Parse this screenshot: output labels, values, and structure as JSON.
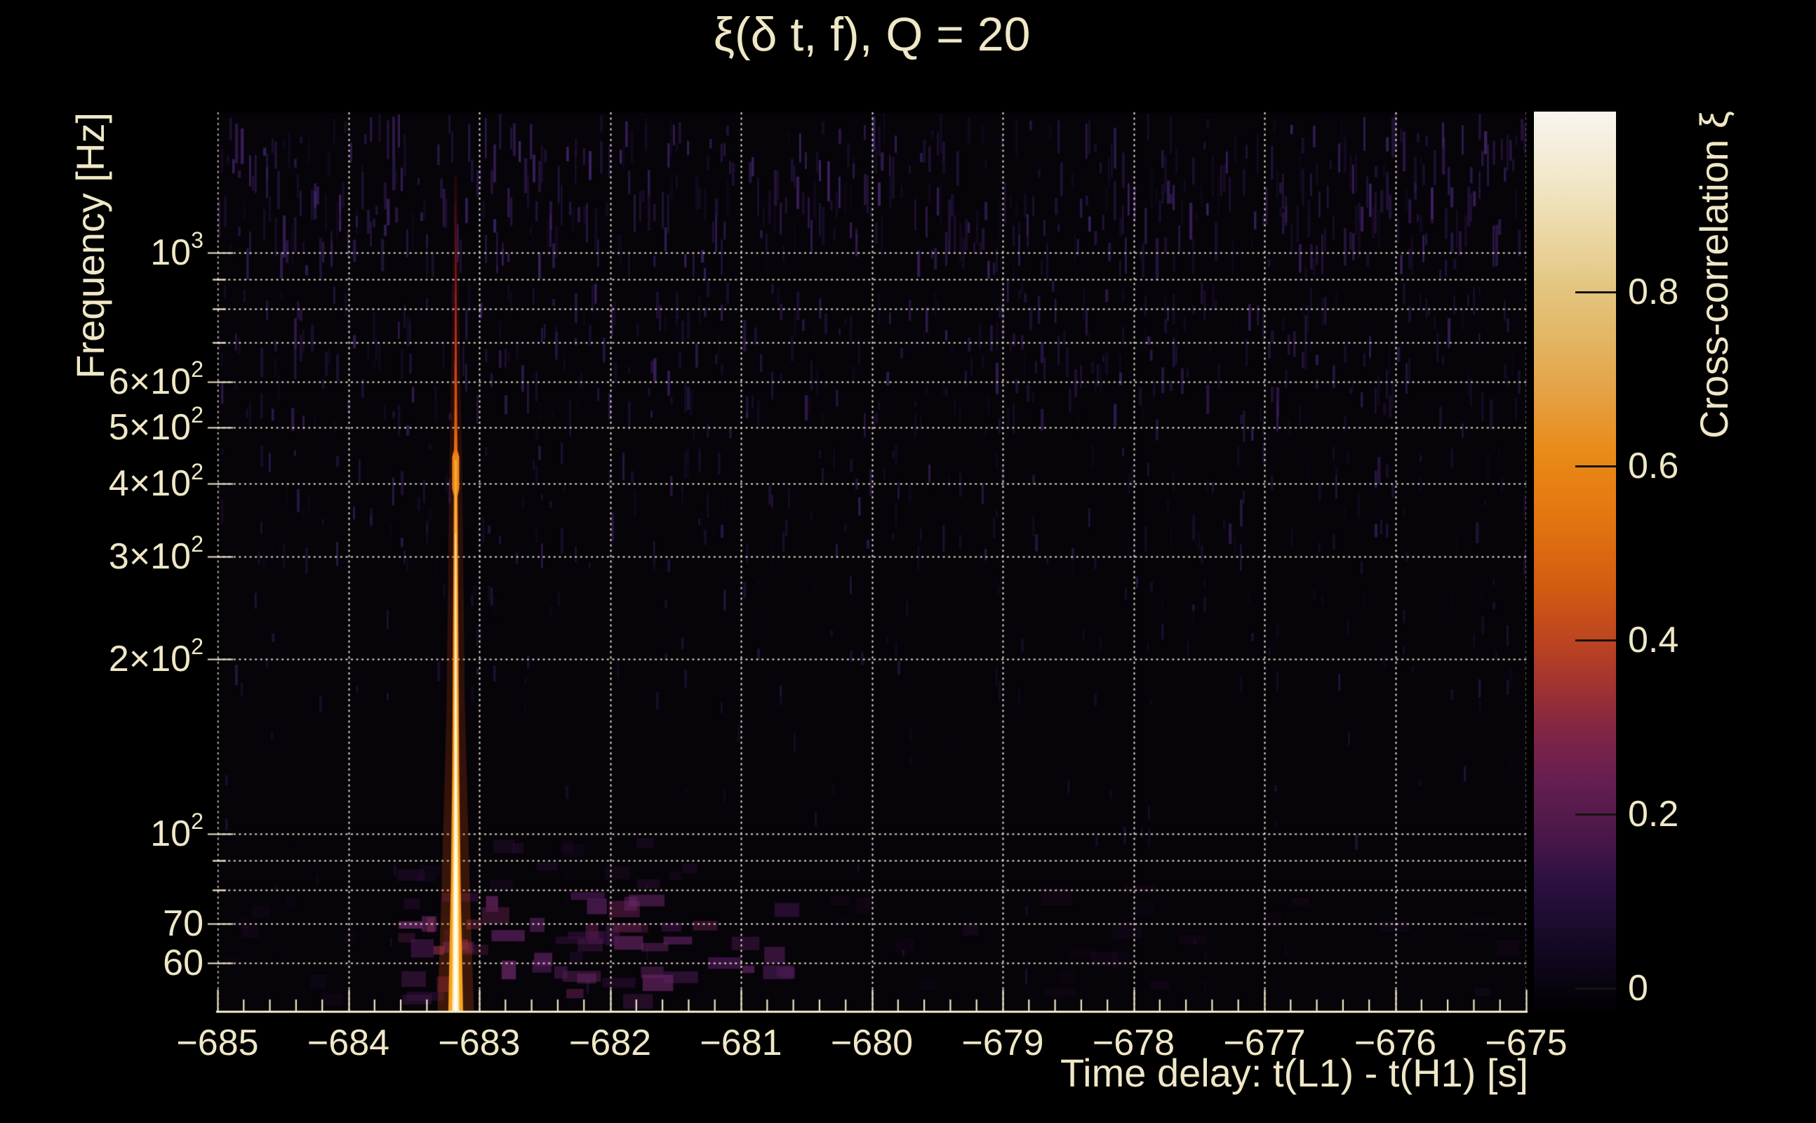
{
  "title": "ξ(δ t, f), Q = 20",
  "axes": {
    "x": {
      "label": "Time delay: t(L1) - t(H1) [s]",
      "ticks": [
        {
          "v": -685,
          "label": "−685"
        },
        {
          "v": -684,
          "label": "−684"
        },
        {
          "v": -683,
          "label": "−683"
        },
        {
          "v": -682,
          "label": "−682"
        },
        {
          "v": -681,
          "label": "−681"
        },
        {
          "v": -680,
          "label": "−680"
        },
        {
          "v": -679,
          "label": "−679"
        },
        {
          "v": -678,
          "label": "−678"
        },
        {
          "v": -677,
          "label": "−677"
        },
        {
          "v": -676,
          "label": "−676"
        },
        {
          "v": -675,
          "label": "−675"
        }
      ],
      "minor_step": 0.2
    },
    "y": {
      "label": "Frequency [Hz]",
      "ticks": [
        {
          "v": 1000,
          "label": "10^3"
        },
        {
          "v": 600,
          "label": "6×10^2"
        },
        {
          "v": 500,
          "label": "5×10^2"
        },
        {
          "v": 400,
          "label": "4×10^2"
        },
        {
          "v": 300,
          "label": "3×10^2"
        },
        {
          "v": 200,
          "label": "2×10^2"
        },
        {
          "v": 100,
          "label": "10^2"
        },
        {
          "v": 70,
          "label": "70"
        },
        {
          "v": 60,
          "label": "60"
        }
      ],
      "minor_ticks": [
        900,
        800,
        700,
        90,
        80
      ]
    }
  },
  "colorbar": {
    "label": "Cross-correlation ξ",
    "ticks": [
      {
        "v": 0,
        "label": "0"
      },
      {
        "v": 0.2,
        "label": "0.2"
      },
      {
        "v": 0.4,
        "label": "0.4"
      },
      {
        "v": 0.6,
        "label": "0.6"
      },
      {
        "v": 0.8,
        "label": "0.8"
      }
    ],
    "gradient": [
      [
        0,
        "#020103"
      ],
      [
        7,
        "#130822"
      ],
      [
        14,
        "#2a1040"
      ],
      [
        20,
        "#4c1849"
      ],
      [
        26,
        "#671f50"
      ],
      [
        31,
        "#812546"
      ],
      [
        36,
        "#a03232"
      ],
      [
        41,
        "#bc4420"
      ],
      [
        47,
        "#d25b12"
      ],
      [
        55,
        "#e4760f"
      ],
      [
        62,
        "#e98a17"
      ],
      [
        69,
        "#e5a246"
      ],
      [
        75,
        "#e2b765"
      ],
      [
        80,
        "#e3c47e"
      ],
      [
        87,
        "#ecd9a8"
      ],
      [
        93,
        "#f2e8cc"
      ],
      [
        100,
        "#f7f5ee"
      ]
    ]
  },
  "colors": {
    "background": "#000000",
    "plot_background": "#060309",
    "text": "#efe7c6",
    "axis_line": "#f2e9c9",
    "gridline": "rgba(244,236,212,0.95)",
    "tick_mark_dark": "#171310",
    "noise_palette": [
      "#1a0d2b",
      "#221239",
      "#2b1747",
      "#341d55",
      "#140a20",
      "#3c2260"
    ]
  },
  "chart_data": {
    "type": "heatmap",
    "title": "ξ(δ t, f), Q = 20",
    "xlabel": "Time delay: t(L1) - t(H1) [s]",
    "ylabel": "Frequency [Hz]",
    "colorbar_label": "Cross-correlation ξ",
    "xlim": [
      -685,
      -675
    ],
    "ylim_hz": [
      50,
      1750
    ],
    "y_scale": "log",
    "value_range": [
      -0.03,
      1.0
    ],
    "grid": "dotted, at all major and minor log ticks",
    "main_feature": {
      "description": "Single narrow vertical streak of high cross-correlation at fixed time delay, brightest (ξ≈1) at 50–200 Hz, fading with increasing frequency; faint red trace visible up to ~1500 Hz; widened orange knot near 400 Hz; diffuse purple patches around the base between 50 and 90 Hz for delays −683.6 to −679 s; remainder of map is near-zero noise (ξ≈0–0.1) of faint vertical purple striations, densest above 500 Hz.",
      "t_delay_s": -683.2,
      "freq_extent_hz": [
        50,
        1500
      ],
      "peak_xi": 1.0
    },
    "streak": {
      "t": -683.18,
      "layers": [
        {
          "name": "glow",
          "points": [
            [
              250,
              6,
              "#be3c12",
              0.06
            ],
            [
              430,
              10,
              "#be3c12",
              0.12
            ],
            [
              640,
              18,
              "#c84a10",
              0.16
            ],
            [
              1000,
              26,
              "#c84a10",
              0.2
            ],
            [
              1260,
              40,
              "#d0500e",
              0.24
            ],
            [
              1440,
              52,
              "#d0500e",
              0.26
            ]
          ]
        },
        {
          "name": "main",
          "points": [
            [
              250,
              1.6,
              "#4a0c1c",
              0.45
            ],
            [
              340,
              2,
              "#7c1220",
              0.85
            ],
            [
              430,
              2.6,
              "#a61e1c",
              1
            ],
            [
              520,
              3.2,
              "#c83e12",
              1
            ],
            [
              600,
              4,
              "#de5c0e",
              1
            ],
            [
              640,
              5,
              "#e86c10",
              1
            ],
            [
              650,
              10,
              "#ef8618",
              1
            ],
            [
              695,
              10,
              "#ef8618",
              1
            ],
            [
              706,
              5.5,
              "#ec7a12",
              1
            ],
            [
              800,
              6.5,
              "#f08214",
              1
            ],
            [
              940,
              8,
              "#f28a16",
              1
            ],
            [
              1100,
              10,
              "#f39018",
              1
            ],
            [
              1260,
              14,
              "#f59a1c",
              1
            ],
            [
              1360,
              18,
              "#f6a020",
              1
            ],
            [
              1440,
              21,
              "#f7a522",
              1
            ]
          ]
        },
        {
          "name": "inner",
          "points": [
            [
              655,
              3,
              "#fbae3c",
              0.9
            ],
            [
              706,
              2.6,
              "#fbb242",
              0.9
            ],
            [
              800,
              3.2,
              "#fcba4a",
              1
            ],
            [
              940,
              4.2,
              "#fdc455",
              1
            ],
            [
              1100,
              5.5,
              "#fdd068",
              1
            ],
            [
              1260,
              8,
              "#ffe08a",
              1
            ],
            [
              1440,
              10,
              "#ffe89c",
              1
            ]
          ]
        },
        {
          "name": "core",
          "points": [
            [
              760,
              1.2,
              "#fff0c8",
              0.8
            ],
            [
              940,
              2,
              "#fff4d4",
              1
            ],
            [
              1100,
              2.8,
              "#fff8e2",
              1
            ],
            [
              1260,
              4,
              "#fffcf0",
              1
            ],
            [
              1440,
              5,
              "#fffdf6",
              1
            ]
          ]
        }
      ]
    },
    "noise_bands": [
      {
        "y0": 160,
        "y1": 400,
        "step": 4,
        "prob": 0.85,
        "h": [
          10,
          60
        ],
        "a": [
          0.45,
          1.0
        ]
      },
      {
        "y0": 400,
        "y1": 630,
        "step": 4,
        "prob": 0.6,
        "h": [
          8,
          45
        ],
        "a": [
          0.35,
          0.9
        ]
      },
      {
        "y0": 630,
        "y1": 820,
        "step": 4,
        "prob": 0.32,
        "h": [
          8,
          40
        ],
        "a": [
          0.3,
          0.75
        ]
      },
      {
        "y0": 820,
        "y1": 1020,
        "step": 4,
        "prob": 0.16,
        "h": [
          8,
          30
        ],
        "a": [
          0.25,
          0.6
        ]
      },
      {
        "y0": 1020,
        "y1": 1230,
        "step": 5,
        "prob": 0.07,
        "h": [
          8,
          26
        ],
        "a": [
          0.2,
          0.5
        ]
      },
      {
        "y0": 1230,
        "y1": 1436,
        "step": 5,
        "prob": 0.03,
        "h": [
          8,
          22
        ],
        "a": [
          0.15,
          0.4
        ]
      }
    ],
    "blob_groups": [
      {
        "x": [
          556,
          1165
        ],
        "y": [
          1270,
          1438
        ],
        "count": 55,
        "w": [
          16,
          55
        ],
        "h": [
          10,
          28
        ],
        "a": [
          0.3,
          0.8
        ],
        "colors": [
          "#3a1244",
          "#4b1a55",
          "#5e2262",
          "#6b2768",
          "#511a40"
        ]
      },
      {
        "x": [
          556,
          1000
        ],
        "y": [
          1180,
          1270
        ],
        "count": 14,
        "w": [
          14,
          40
        ],
        "h": [
          8,
          20
        ],
        "a": [
          0.15,
          0.4
        ],
        "colors": [
          "#331040",
          "#40164e"
        ]
      },
      {
        "x": [
          600,
          700
        ],
        "y": [
          1300,
          1430
        ],
        "count": 6,
        "w": [
          10,
          26
        ],
        "h": [
          10,
          24
        ],
        "a": [
          0.4,
          0.7
        ],
        "colors": [
          "#7c2447",
          "#8a2c4e"
        ]
      },
      {
        "x": [
          1165,
          2165
        ],
        "y": [
          1255,
          1432
        ],
        "count": 26,
        "w": [
          18,
          50
        ],
        "h": [
          10,
          26
        ],
        "a": [
          0.05,
          0.13
        ],
        "colors": [
          "#4b1a55",
          "#5e2262"
        ]
      },
      {
        "x": [
          320,
          556
        ],
        "y": [
          1260,
          1436
        ],
        "count": 8,
        "w": [
          14,
          36
        ],
        "h": [
          8,
          20
        ],
        "a": [
          0.05,
          0.15
        ],
        "colors": [
          "#40164e"
        ]
      }
    ]
  }
}
